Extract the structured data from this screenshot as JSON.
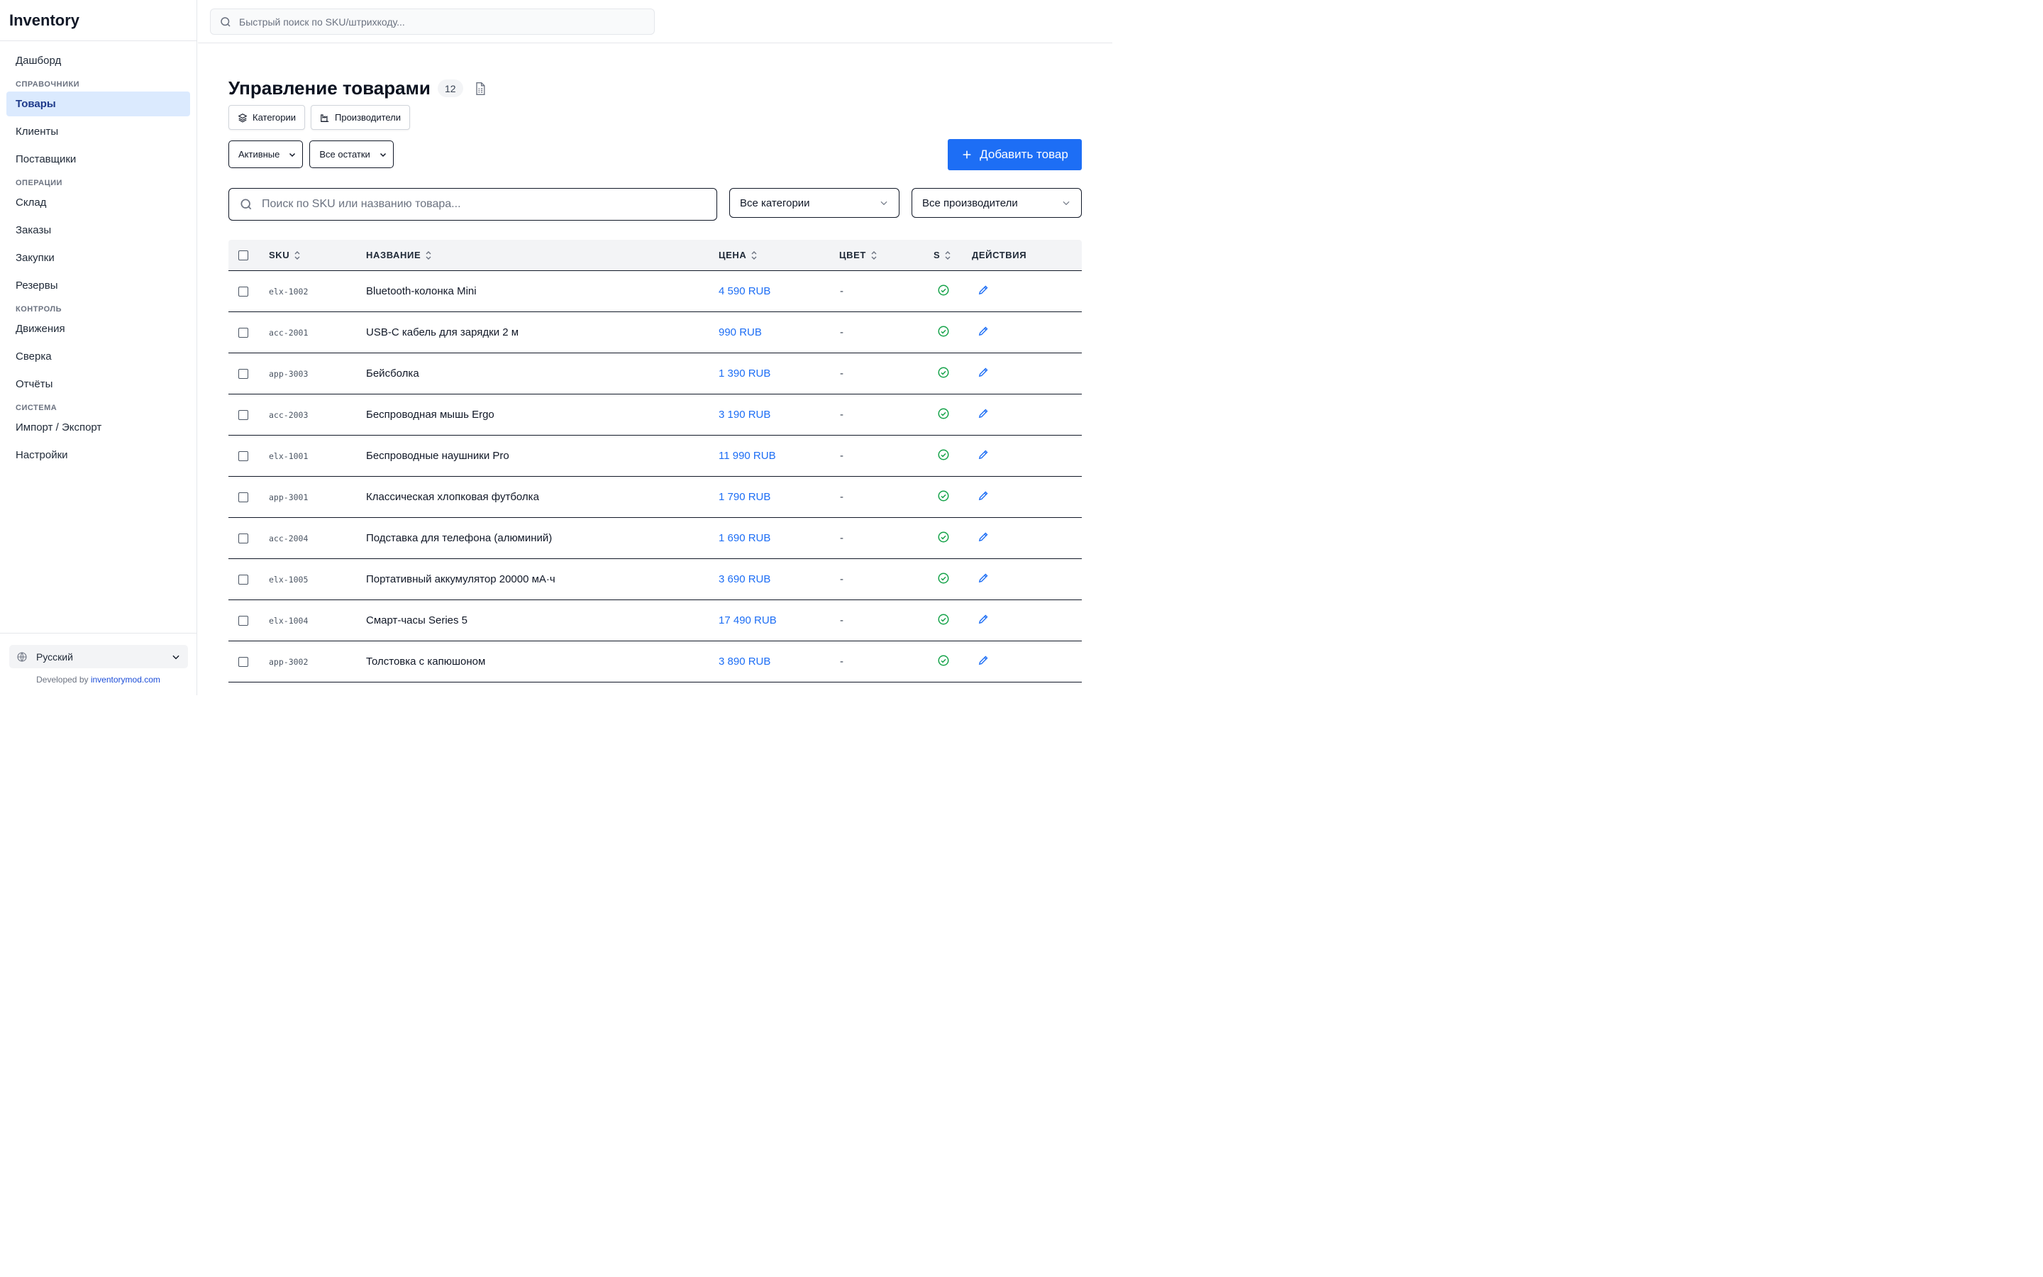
{
  "sidebar": {
    "brand": "Inventory",
    "top_item": "Дашборд",
    "sections": [
      {
        "title": "СПРАВОЧНИКИ",
        "items": [
          "Товары",
          "Клиенты",
          "Поставщики"
        ]
      },
      {
        "title": "ОПЕРАЦИИ",
        "items": [
          "Склад",
          "Заказы",
          "Закупки",
          "Резервы"
        ]
      },
      {
        "title": "КОНТРОЛЬ",
        "items": [
          "Движения",
          "Сверка",
          "Отчёты"
        ]
      },
      {
        "title": "СИСТЕМА",
        "items": [
          "Импорт / Экспорт",
          "Настройки"
        ]
      }
    ],
    "active_item": "Товары",
    "language": "Русский",
    "dev_prefix": "Developed by",
    "dev_link": "inventorymod.com"
  },
  "topbar": {
    "search_placeholder": "Быстрый поиск по SKU/штрихкоду..."
  },
  "page": {
    "title": "Управление товарами",
    "count": "12",
    "buttons": {
      "categories": "Категории",
      "manufacturers": "Производители",
      "add": "Добавить товар"
    },
    "filters": {
      "status": "Активные",
      "stock": "Все остатки",
      "category": "Все категории",
      "manufacturer": "Все производители"
    },
    "search_placeholder": "Поиск по SKU или названию товара..."
  },
  "table": {
    "columns": {
      "sku": "SKU",
      "name": "НАЗВАНИЕ",
      "price": "ЦЕНА",
      "color": "ЦВЕТ",
      "s": "S",
      "actions": "ДЕЙСТВИЯ"
    },
    "rows": [
      {
        "sku": "elx-1002",
        "name": "Bluetooth-колонка Mini",
        "price": "4 590 RUB",
        "color": "-"
      },
      {
        "sku": "acc-2001",
        "name": "USB-C кабель для зарядки 2 м",
        "price": "990 RUB",
        "color": "-"
      },
      {
        "sku": "app-3003",
        "name": "Бейсболка",
        "price": "1 390 RUB",
        "color": "-"
      },
      {
        "sku": "acc-2003",
        "name": "Беспроводная мышь Ergo",
        "price": "3 190 RUB",
        "color": "-"
      },
      {
        "sku": "elx-1001",
        "name": "Беспроводные наушники Pro",
        "price": "11 990 RUB",
        "color": "-"
      },
      {
        "sku": "app-3001",
        "name": "Классическая хлопковая футболка",
        "price": "1 790 RUB",
        "color": "-"
      },
      {
        "sku": "acc-2004",
        "name": "Подставка для телефона (алюминий)",
        "price": "1 690 RUB",
        "color": "-"
      },
      {
        "sku": "elx-1005",
        "name": "Портативный аккумулятор 20000 мА·ч",
        "price": "3 690 RUB",
        "color": "-"
      },
      {
        "sku": "elx-1004",
        "name": "Смарт-часы Series 5",
        "price": "17 490 RUB",
        "color": "-"
      },
      {
        "sku": "app-3002",
        "name": "Толстовка с капюшоном",
        "price": "3 890 RUB",
        "color": "-"
      }
    ]
  },
  "colors": {
    "accent": "#1d6ef5",
    "active_nav_bg": "#dbeafe",
    "status_ok": "#16a34a"
  },
  "icons": {
    "status": "check-circle-icon",
    "edit": "pencil-icon",
    "search": "search-icon",
    "layers": "layers-icon",
    "factory": "factory-icon",
    "document": "document-icon",
    "globe": "globe-icon"
  }
}
